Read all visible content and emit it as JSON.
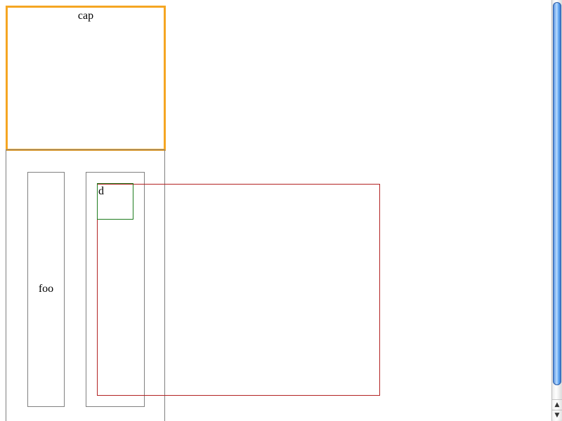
{
  "caption": {
    "text": "cap",
    "border_color": "#f5a623"
  },
  "cells": {
    "foo_text": "foo",
    "d_text": "d"
  },
  "colors": {
    "red_box_border": "#b22222",
    "green_box_border": "#1e7b1e",
    "cell_border": "#808080",
    "scroll_thumb": "#3f7fd8"
  },
  "scrollbar": {
    "up_icon": "▲",
    "down_icon": "▼",
    "up_icon_name": "arrow-up-icon",
    "down_icon_name": "arrow-down-icon"
  }
}
